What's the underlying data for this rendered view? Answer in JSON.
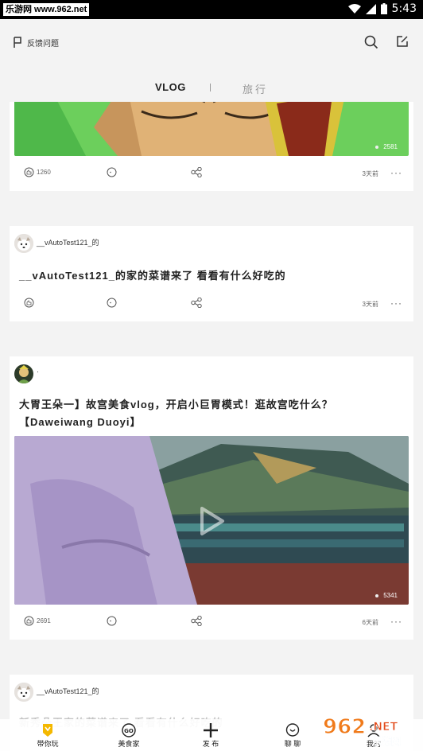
{
  "status_bar": {
    "watermark": "乐游网 www.962.net",
    "time": "5:43"
  },
  "header": {
    "feedback_label": "反馈问题",
    "tabs": [
      {
        "label": "VLOG"
      },
      {
        "label": "旅行"
      }
    ]
  },
  "feed": [
    {
      "likes": "1260",
      "time": "3天前",
      "views": "2581",
      "more": "···"
    },
    {
      "username": "__vAutoTest121_的",
      "title": "__vAutoTest121_的家的菜谱来了 看看有什么好吃的",
      "time": "3天前",
      "more": "···"
    },
    {
      "username": "·",
      "title_line1": "大胃王朵一】故宫美食vlog，开启小巨胃模式！逛故宫吃什么？",
      "title_line2": "【Daweiwang Duoyi】",
      "likes": "2691",
      "time": "6天前",
      "views": "5341",
      "more": "···"
    },
    {
      "username": "__vAutoTest121_的",
      "title": "新秀朵王家的菜谱来了 看看有什么好吃的"
    }
  ],
  "bottom_nav": [
    {
      "label": "带你玩",
      "icon": "badge-icon"
    },
    {
      "label": "美食家",
      "icon": "go-icon"
    },
    {
      "label": "发 布",
      "icon": "plus-icon"
    },
    {
      "label": "聊 聊",
      "icon": "chat-icon"
    },
    {
      "label": "我的",
      "icon": "profile-icon"
    }
  ],
  "watermark_962": {
    "brand": "962.NET",
    "sub": "乐游网"
  },
  "colors": {
    "accent_yellow": "#f4b800",
    "background": "#f3f3f3"
  }
}
